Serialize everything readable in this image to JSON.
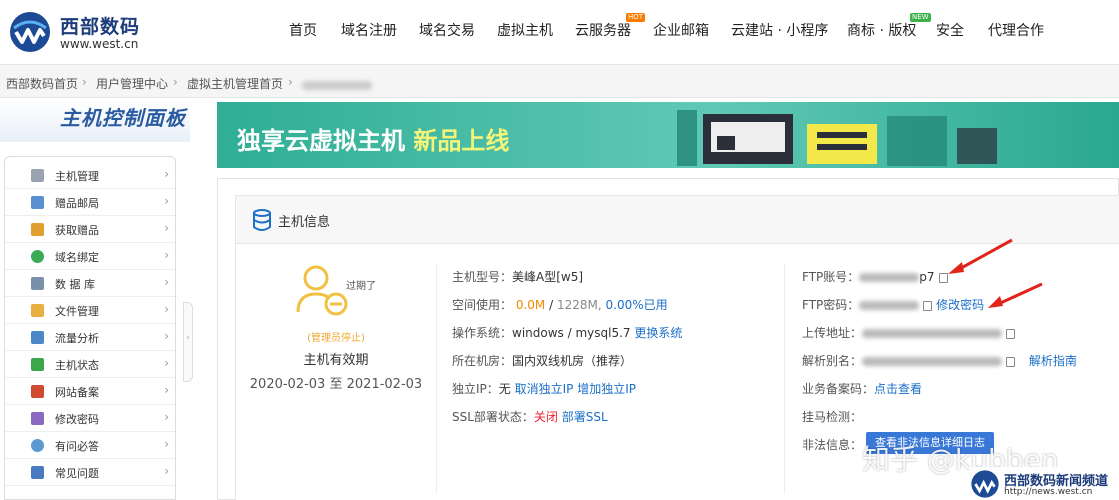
{
  "brand": {
    "name": "西部数码",
    "url": "www.west.cn"
  },
  "nav": [
    {
      "label": "首页"
    },
    {
      "label": "域名注册"
    },
    {
      "label": "域名交易"
    },
    {
      "label": "虚拟主机"
    },
    {
      "label": "云服务器",
      "badge": "HOT",
      "badge_color": "#ff7a00"
    },
    {
      "label": "企业邮箱"
    },
    {
      "label": "云建站 · 小程序"
    },
    {
      "label": "商标 · 版权",
      "badge": "NEW",
      "badge_color": "#3bb34a"
    },
    {
      "label": "安全"
    },
    {
      "label": "代理合作"
    }
  ],
  "breadcrumb": [
    "西部数码首页",
    "用户管理中心",
    "虚拟主机管理首页"
  ],
  "sidebar": {
    "title": "主机控制面板",
    "items": [
      {
        "label": "主机管理",
        "icon": "server-icon",
        "color": "#9aa4b0"
      },
      {
        "label": "赠品邮局",
        "icon": "mail-icon",
        "color": "#5a8fd0"
      },
      {
        "label": "获取赠品",
        "icon": "gift-icon",
        "color": "#e0a030"
      },
      {
        "label": "域名绑定",
        "icon": "globe-icon",
        "color": "#3aaa55"
      },
      {
        "label": "数 据 库",
        "icon": "database-icon",
        "color": "#7a8fa8"
      },
      {
        "label": "文件管理",
        "icon": "folder-icon",
        "color": "#e8b040"
      },
      {
        "label": "流量分析",
        "icon": "chart-icon",
        "color": "#4a88c8"
      },
      {
        "label": "主机状态",
        "icon": "status-icon",
        "color": "#3aa84a"
      },
      {
        "label": "网站备案",
        "icon": "pen-icon",
        "color": "#d04a30"
      },
      {
        "label": "修改密码",
        "icon": "key-icon",
        "color": "#8a6ac0"
      },
      {
        "label": "有问必答",
        "icon": "person-icon",
        "color": "#5a9ad0"
      },
      {
        "label": "常见问题",
        "icon": "help-icon",
        "color": "#4a7ac0"
      }
    ]
  },
  "banner": {
    "text": "独享云虚拟主机",
    "highlight": "新品上线"
  },
  "host": {
    "section_title": "主机信息",
    "expired_label": "过期了",
    "stopped_label": "(管理员停止)",
    "validity_label": "主机有效期",
    "start_date": "2020-02-03",
    "to": "至",
    "end_date": "2021-02-03"
  },
  "info_mid": {
    "model_k": "主机型号：",
    "model_v": "美峰A型[w5]",
    "space_k": "空间使用：",
    "space_used": "0.0M",
    "slash": "/",
    "space_total": "1228M,",
    "space_pct": "0.00%已用",
    "os_k": "操作系统：",
    "os_v": "windows / mysql5.7",
    "os_link": "更换系统",
    "room_k": "所在机房：",
    "room_v": "国内双线机房（推荐）",
    "ip_k": "独立IP：",
    "ip_v": "无",
    "ip_cancel": "取消独立IP",
    "ip_add": "增加独立IP",
    "ssl_k": "SSL部署状态：",
    "ssl_v": "关闭",
    "ssl_link": "部署SSL"
  },
  "info_right": {
    "ftp_user_k": "FTP账号：",
    "ftp_user_tail": "p7",
    "ftp_pwd_k": "FTP密码：",
    "change_pwd": "修改密码",
    "upload_k": "上传地址：",
    "alias_k": "解析别名：",
    "alias_link": "解析指南",
    "icp_k": "业务备案码：",
    "icp_link": "点击查看",
    "hang_k": "挂马检测：",
    "illegal_k": "非法信息：",
    "illegal_btn": "查看非法信息详细日志"
  },
  "watermark": "知乎 @kubben",
  "footer": {
    "name": "西部数码新闻频道",
    "url": "http://news.west.cn"
  }
}
